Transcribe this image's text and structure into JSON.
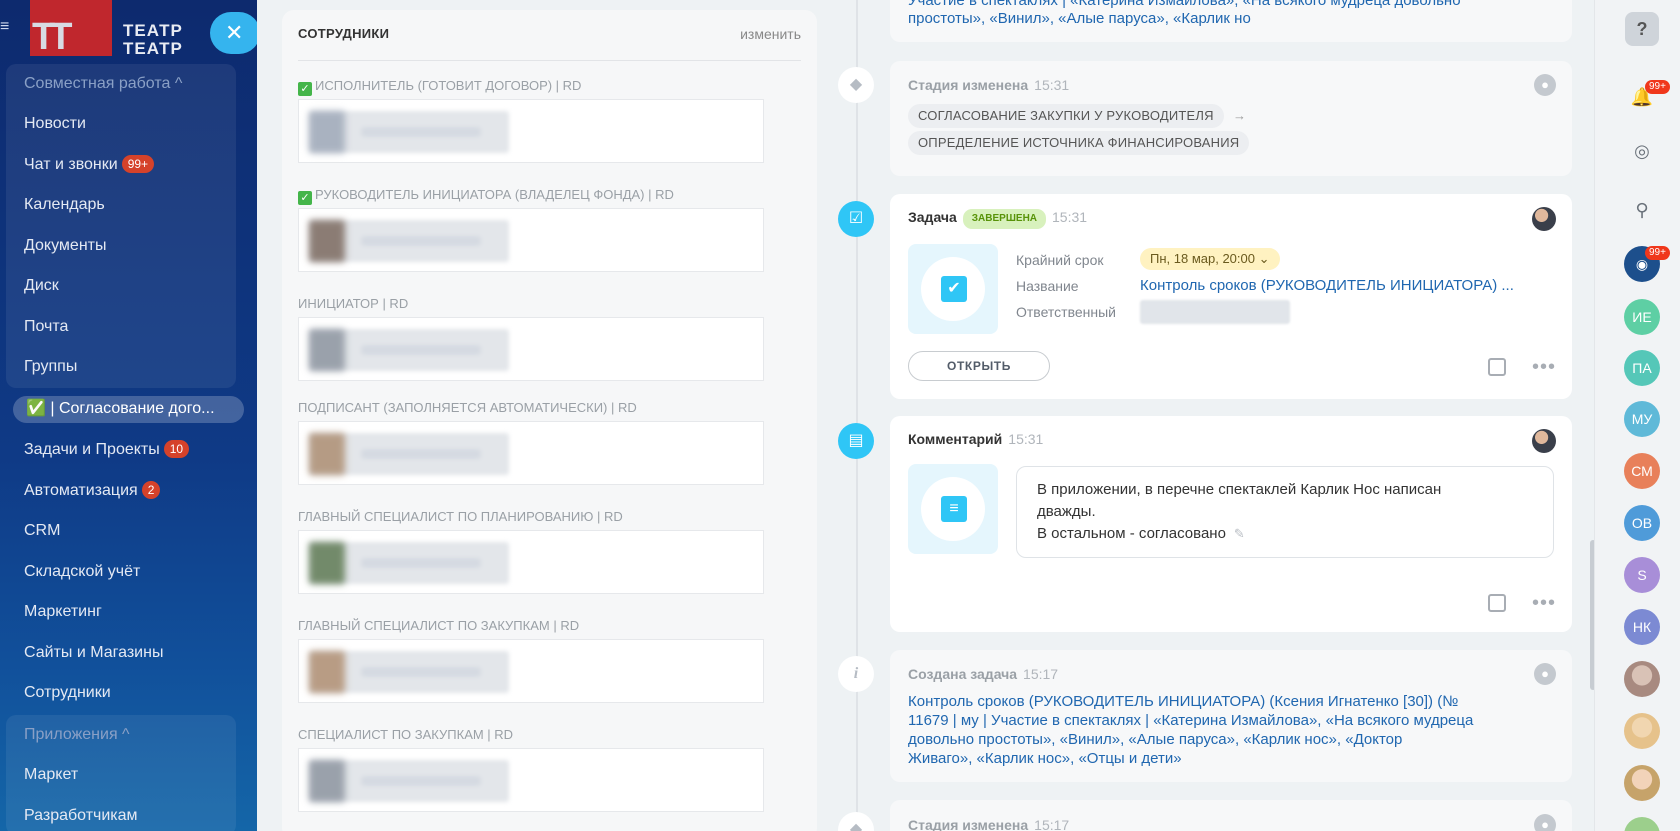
{
  "sidebar": {
    "logo_mark": "TT",
    "logo_text_line1": "ТЕАТР",
    "logo_text_line2": "ТЕАТР",
    "items": [
      {
        "label": "Совместная работа ^"
      },
      {
        "label": "Новости"
      },
      {
        "label": "Чат и звонки",
        "badge": "99+"
      },
      {
        "label": "Календарь"
      },
      {
        "label": "Документы"
      },
      {
        "label": "Диск"
      },
      {
        "label": "Почта"
      },
      {
        "label": "Группы"
      },
      {
        "label": "✅ | Согласование дого..."
      },
      {
        "label": "Задачи и Проекты",
        "badge": "10"
      },
      {
        "label": "Автоматизация",
        "badge": "2"
      },
      {
        "label": "CRM"
      },
      {
        "label": "Складской учёт"
      },
      {
        "label": "Маркетинг"
      },
      {
        "label": "Сайты и Магазины"
      },
      {
        "label": "Сотрудники"
      },
      {
        "label": "Приложения ^"
      },
      {
        "label": "Маркет"
      },
      {
        "label": "Разработчикам"
      }
    ]
  },
  "employees": {
    "title": "СОТРУДНИКИ",
    "edit": "изменить",
    "roles": [
      {
        "label": "ИСПОЛНИТЕЛЬ (ГОТОВИТ ДОГОВОР) | RD",
        "checked": true
      },
      {
        "label": "РУКОВОДИТЕЛЬ ИНИЦИАТОРА (ВЛАДЕЛЕЦ ФОНДА) | RD",
        "checked": true
      },
      {
        "label": "ИНИЦИАТОР | RD",
        "checked": false
      },
      {
        "label": "ПОДПИСАНТ (ЗАПОЛНЯЕТСЯ АВТОМАТИЧЕСКИ) | RD",
        "checked": false
      },
      {
        "label": "ГЛАВНЫЙ СПЕЦИАЛИСТ ПО ПЛАНИРОВАНИЮ | RD",
        "checked": false
      },
      {
        "label": "ГЛАВНЫЙ СПЕЦИАЛИСТ ПО ЗАКУПКАМ | RD",
        "checked": false
      },
      {
        "label": "СПЕЦИАЛИСТ ПО ЗАКУПКАМ | RD",
        "checked": false
      }
    ]
  },
  "timeline": {
    "top_fragment_line1": "Участие в спектаклях | «Катерина Измайлова», «На всякого мудреца довольно",
    "top_fragment_line2": "простоты», «Винил», «Алые паруса», «Карлик но",
    "stage1": {
      "title": "Стадия изменена",
      "time": "15:31",
      "from": "СОГЛАСОВАНИЕ ЗАКУПКИ У РУКОВОДИТЕЛЯ",
      "arrow": "→",
      "to": "ОПРЕДЕЛЕНИЕ ИСТОЧНИКА ФИНАНСИРОВАНИЯ"
    },
    "task": {
      "title": "Задача",
      "status": "ЗАВЕРШЕНА",
      "time": "15:31",
      "deadline_label": "Крайний срок",
      "deadline_value": "Пн, 18 мар, 20:00",
      "name_label": "Название",
      "name_value": "Контроль сроков (РУКОВОДИТЕЛЬ ИНИЦИАТОРА) ...",
      "responsible_label": "Ответственный",
      "open_button": "ОТКРЫТЬ"
    },
    "comment": {
      "title": "Комментарий",
      "time": "15:31",
      "text_line1": "В приложении, в перечне спектаклей Карлик Нос написан",
      "text_line2": "дважды.",
      "text_line3": "В остальном - согласовано"
    },
    "created": {
      "title": "Создана задача",
      "time": "15:17",
      "line1": "Контроль сроков (РУКОВОДИТЕЛЬ ИНИЦИАТОРА) (Ксения Игнатенко [30]) (№",
      "line2": "11679 | му | Участие в спектаклях | «Катерина Измайлова», «На всякого мудреца",
      "line3": "довольно простоты», «Винил», «Алые паруса», «Карлик нос», «Доктор",
      "line4": "Живаго», «Карлик нос», «Отцы и дети»"
    },
    "stage2": {
      "title": "Стадия изменена",
      "time": "15:17"
    }
  },
  "rightbar": {
    "help": "?",
    "notifications_badge": "99+",
    "chat_badge": "99+",
    "avatars": [
      {
        "initials": "ИЕ",
        "color": "#5ecfa4"
      },
      {
        "initials": "ПА",
        "color": "#55c7b8"
      },
      {
        "initials": "МУ",
        "color": "#5fb9d8"
      },
      {
        "initials": "СМ",
        "color": "#e8805a"
      },
      {
        "initials": "ОВ",
        "color": "#4f9bd9"
      },
      {
        "initials": "S",
        "color": "#a88ed8"
      },
      {
        "initials": "НК",
        "color": "#7c8ad3"
      }
    ]
  }
}
